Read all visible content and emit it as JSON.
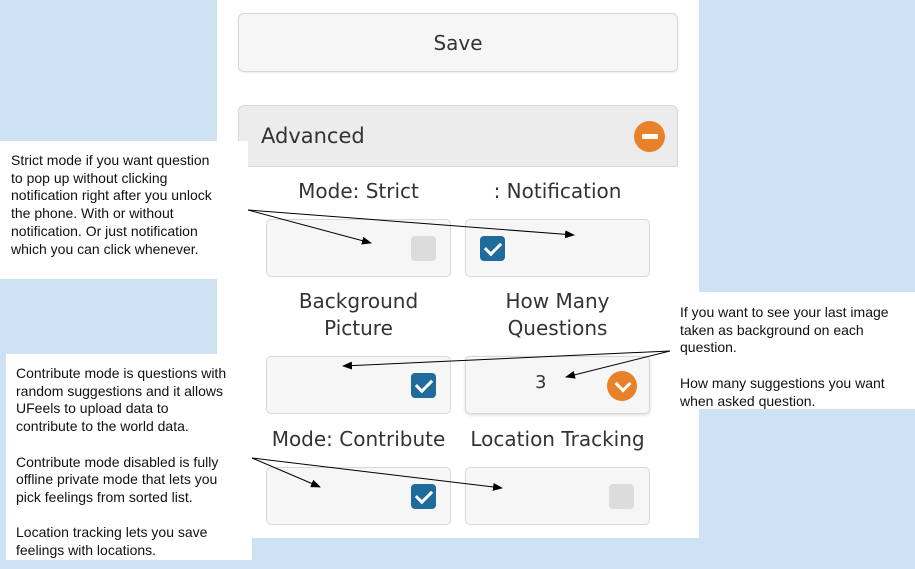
{
  "form": {
    "save_label": "Save",
    "advanced_label": "Advanced",
    "mode_strict_label": "Mode: Strict",
    "notification_label": ": Notification",
    "background_picture_label": "Background\nPicture",
    "how_many_questions_label": "How Many\nQuestions",
    "how_many_questions_value": "3",
    "mode_contribute_label": "Mode: Contribute",
    "location_tracking_label": "Location Tracking",
    "checkboxes": {
      "mode_strict": false,
      "notification": true,
      "background_picture": true,
      "mode_contribute": true,
      "location_tracking": false
    }
  },
  "notes": {
    "strict": "Strict mode if you want question\nto pop up without clicking\nnotification right after you unlock\nthe phone. With or without\nnotification. Or just notification\nwhich you can click whenever.",
    "background": "If you want to see your last image\ntaken as background on each\nquestion.\n\nHow many suggestions you want\nwhen asked question.",
    "contribute": "Contribute mode is questions with\nrandom suggestions and it allows\nUFeels to upload data to\ncontribute to the world data.\n\nContribute mode disabled is fully\noffline private mode that lets you\npick feelings from sorted list.\n\nLocation tracking lets you save\nfeelings with locations."
  },
  "colors": {
    "page_bg": "#cfe2f3",
    "accent": "#e8822a",
    "checkbox_on": "#1f6b9c"
  },
  "icons": [
    "minus-circle-icon",
    "chevron-down-icon",
    "checkmark-icon"
  ]
}
